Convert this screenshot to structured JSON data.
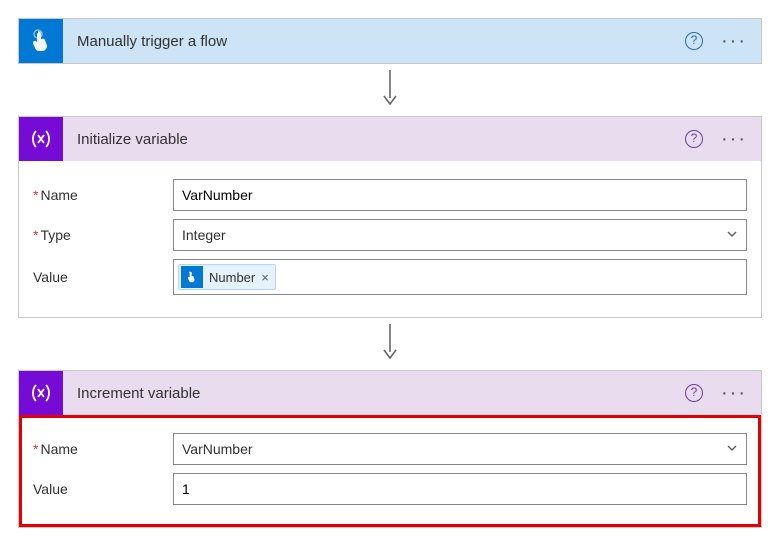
{
  "trigger": {
    "title": "Manually trigger a flow"
  },
  "initVar": {
    "title": "Initialize variable",
    "nameLabel": "Name",
    "nameValue": "VarNumber",
    "typeLabel": "Type",
    "typeValue": "Integer",
    "valueLabel": "Value",
    "tokenLabel": "Number"
  },
  "incVar": {
    "title": "Increment variable",
    "nameLabel": "Name",
    "nameValue": "VarNumber",
    "valueLabel": "Value",
    "valueValue": "1"
  },
  "glyphs": {
    "question": "?",
    "ellipsis": "···",
    "times": "×"
  }
}
